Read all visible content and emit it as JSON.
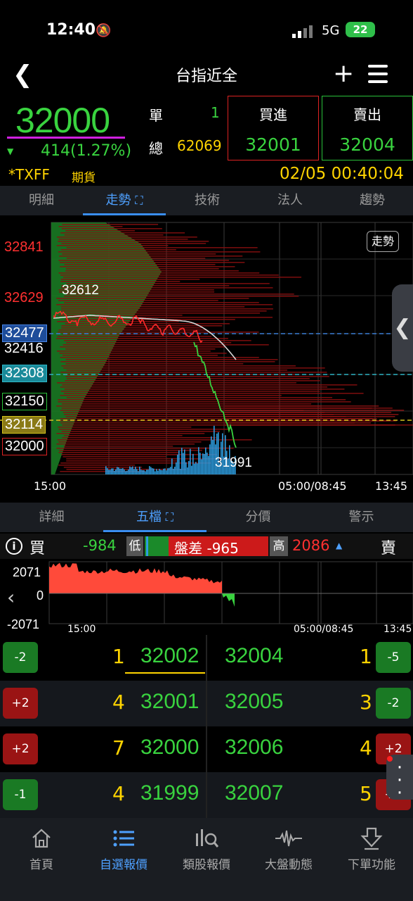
{
  "status_bar": {
    "time": "12:40",
    "network": "5G",
    "battery": "22"
  },
  "nav": {
    "title": "台指近全",
    "back_icon": "chevron-left-icon",
    "add_icon": "plus-icon",
    "menu_icon": "hamburger-menu-icon"
  },
  "quote": {
    "price": "32000",
    "change": "414(1.27%)",
    "single_label": "單",
    "single_value": "1",
    "total_label": "總",
    "total_value": "62069",
    "buy_label": "買進",
    "buy_price": "32001",
    "sell_label": "賣出",
    "sell_price": "32004",
    "symbol": "*TXFF",
    "product_type": "期貨",
    "datetime": "02/05 00:40:04"
  },
  "tabs_top": [
    {
      "label": "明細"
    },
    {
      "label": "走勢",
      "active": true
    },
    {
      "label": "技術"
    },
    {
      "label": "法人"
    },
    {
      "label": "趨勢"
    }
  ],
  "chart_data": {
    "type": "line",
    "mode_label": "走勢",
    "y_labels": [
      "32841",
      "32629",
      "32477",
      "32416",
      "32308",
      "32150",
      "32114",
      "32000"
    ],
    "annotations": {
      "high": "32612",
      "low": "31991"
    },
    "x_labels": [
      "15:00",
      "05:00/08:45",
      "13:45"
    ],
    "colors": {
      "up": "#cc1a1a",
      "down": "#39d33f",
      "avg": "#d8d8d8",
      "volume": "#2d9de0"
    }
  },
  "tabs_bottom": [
    {
      "label": "詳細"
    },
    {
      "label": "五檔",
      "active": true
    },
    {
      "label": "分價"
    },
    {
      "label": "警示"
    }
  ],
  "spread": {
    "buy_label": "買",
    "low_value": "-984",
    "low_label": "低",
    "diff_text": "盤差 -965",
    "high_label": "高",
    "high_value": "2086",
    "sell_label": "賣"
  },
  "mini_chart": {
    "y_labels": [
      "2071",
      "0",
      "-2071"
    ],
    "x_labels": [
      "15:00",
      "05:00/08:45",
      "13:45"
    ]
  },
  "order_book": [
    {
      "bid_chg": "-2",
      "bid_chg_color": "g",
      "bid_qty": "1",
      "bid_price": "32002",
      "ask_price": "32004",
      "ask_qty": "1",
      "ask_chg": "-5",
      "ask_chg_color": "g"
    },
    {
      "bid_chg": "+2",
      "bid_chg_color": "r",
      "bid_qty": "4",
      "bid_price": "32001",
      "ask_price": "32005",
      "ask_qty": "3",
      "ask_chg": "-2",
      "ask_chg_color": "g"
    },
    {
      "bid_chg": "+2",
      "bid_chg_color": "r",
      "bid_qty": "7",
      "bid_price": "32000",
      "ask_price": "32006",
      "ask_qty": "4",
      "ask_chg": "+2",
      "ask_chg_color": "r"
    },
    {
      "bid_chg": "-1",
      "bid_chg_color": "g",
      "bid_qty": "4",
      "bid_price": "31999",
      "ask_price": "32007",
      "ask_qty": "5",
      "ask_chg": "+1",
      "ask_chg_color": "r"
    }
  ],
  "bottom_nav": [
    {
      "label": "首頁",
      "icon": "home-icon"
    },
    {
      "label": "自選報價",
      "icon": "list-icon",
      "active": true
    },
    {
      "label": "類股報價",
      "icon": "chart-search-icon"
    },
    {
      "label": "大盤動態",
      "icon": "pulse-icon"
    },
    {
      "label": "下單功能",
      "icon": "order-icon"
    }
  ]
}
